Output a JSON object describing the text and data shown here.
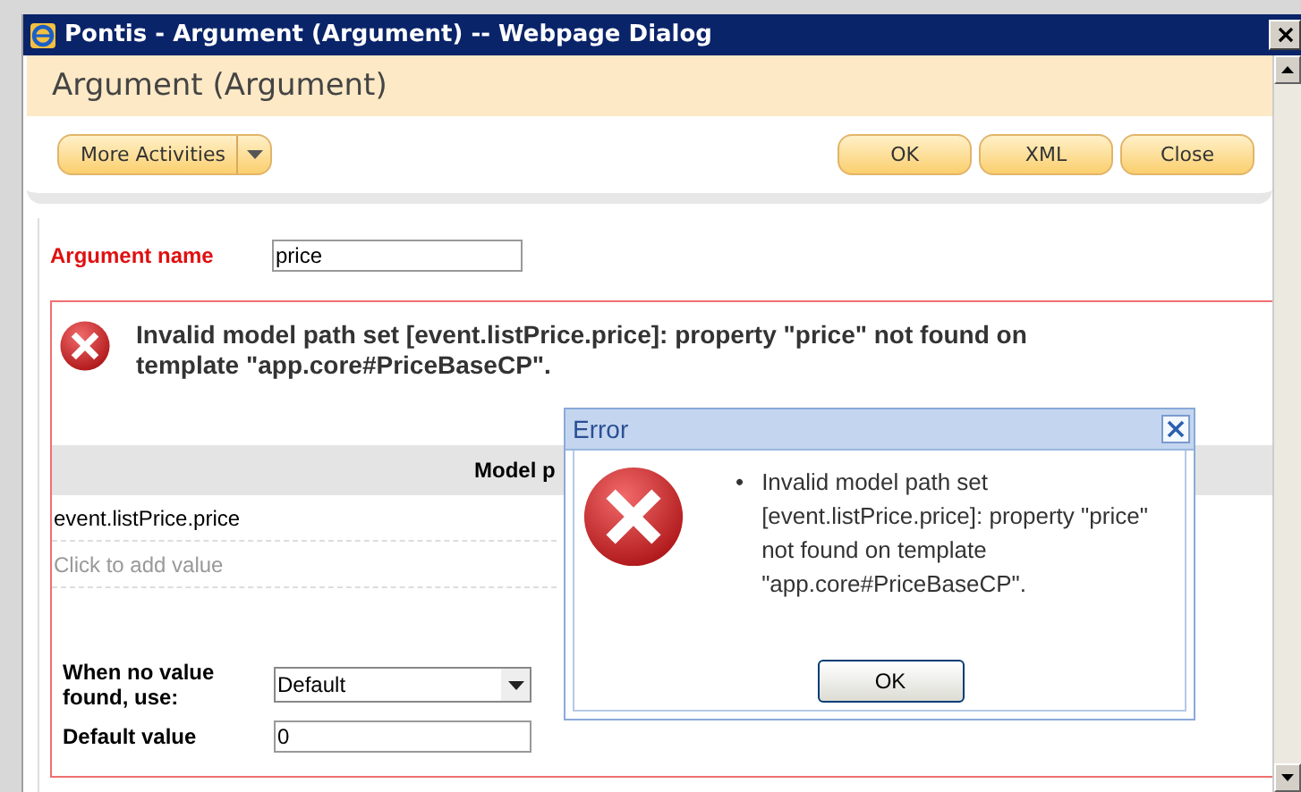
{
  "window": {
    "title": "Pontis - Argument (Argument) -- Webpage Dialog"
  },
  "header": {
    "title": "Argument (Argument)"
  },
  "toolbar": {
    "menu_button": "More Activities",
    "buttons": [
      "OK",
      "XML",
      "Close"
    ]
  },
  "form": {
    "name_label": "Argument name",
    "name_value": "price",
    "error_message": "Invalid model path set [event.listPrice.price]: property \"price\" not found on template \"app.core#PriceBaseCP\".",
    "table": {
      "header": "Model p",
      "rows": [
        "event.listPrice.price"
      ],
      "add_hint": "Click to add value"
    },
    "fallback": {
      "label": "When no value found, use:",
      "value": "Default"
    },
    "default": {
      "label": "Default value",
      "value": "0"
    }
  },
  "error_dialog": {
    "title": "Error",
    "messages": [
      {
        "bullet": "•",
        "text": "Invalid model path set [event.listPrice.price]: property \"price\" not found on template \"app.core#PriceBaseCP\"."
      }
    ],
    "button": "OK"
  }
}
